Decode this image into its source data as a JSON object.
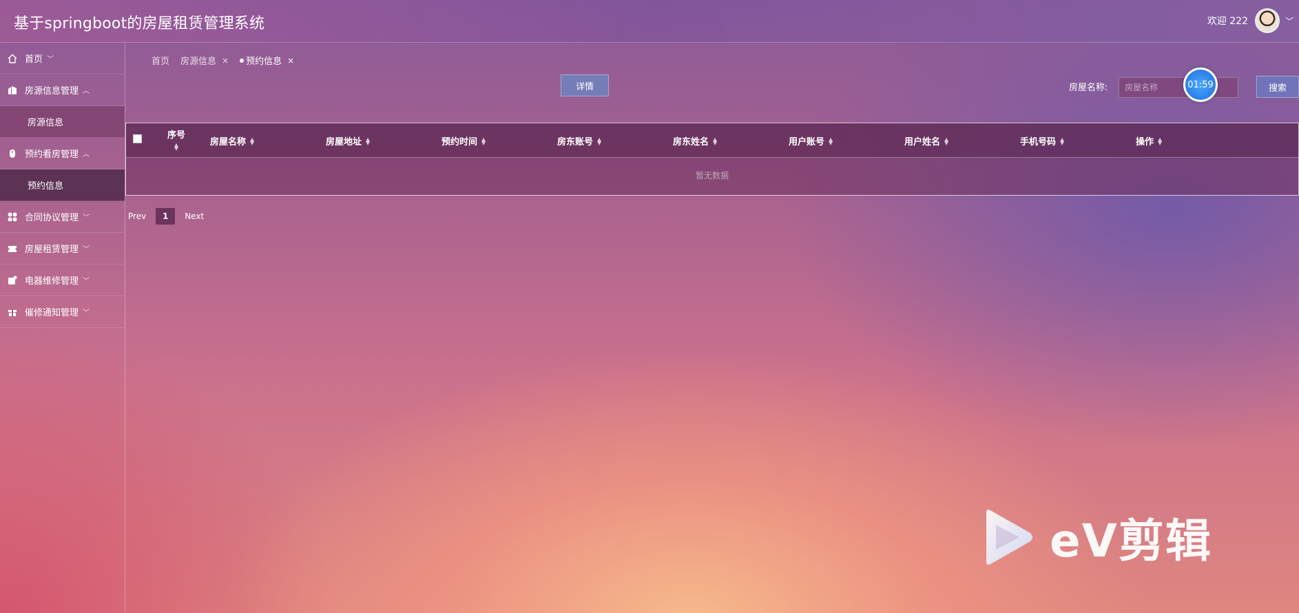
{
  "header": {
    "app_title": "基于springboot的房屋租赁管理系统",
    "welcome": "欢迎 222"
  },
  "sidebar": {
    "items": [
      {
        "label": "首页",
        "icon": "home-icon",
        "arrow": "﹀"
      },
      {
        "label": "房源信息管理",
        "icon": "building-icon",
        "arrow": "︿",
        "sub": "房源信息"
      },
      {
        "label": "预约看房管理",
        "icon": "mouse-icon",
        "arrow": "︿",
        "sub": "预约信息"
      },
      {
        "label": "合同协议管理",
        "icon": "grid-icon",
        "arrow": "﹀"
      },
      {
        "label": "房屋租赁管理",
        "icon": "ticket-icon",
        "arrow": "﹀"
      },
      {
        "label": "电器维修管理",
        "icon": "device-icon",
        "arrow": "﹀"
      },
      {
        "label": "催修通知管理",
        "icon": "gift-icon",
        "arrow": "﹀"
      }
    ]
  },
  "tabs": [
    {
      "label": "首页"
    },
    {
      "label": "房源信息",
      "close": "×"
    },
    {
      "label": "预约信息",
      "close": "×"
    }
  ],
  "toolbar": {
    "detail_label": "详情",
    "search_label": "房屋名称:",
    "search_placeholder": "房屋名称",
    "search_button": "搜索",
    "timer": "01:59"
  },
  "table": {
    "columns": [
      "序号",
      "房屋名称",
      "房屋地址",
      "预约时间",
      "房东账号",
      "房东姓名",
      "用户账号",
      "用户姓名",
      "手机号码",
      "操作"
    ],
    "empty_text": "暂无数据"
  },
  "pagination": {
    "prev": "Prev",
    "page": "1",
    "next": "Next"
  },
  "watermark": {
    "text": "eV剪辑"
  }
}
